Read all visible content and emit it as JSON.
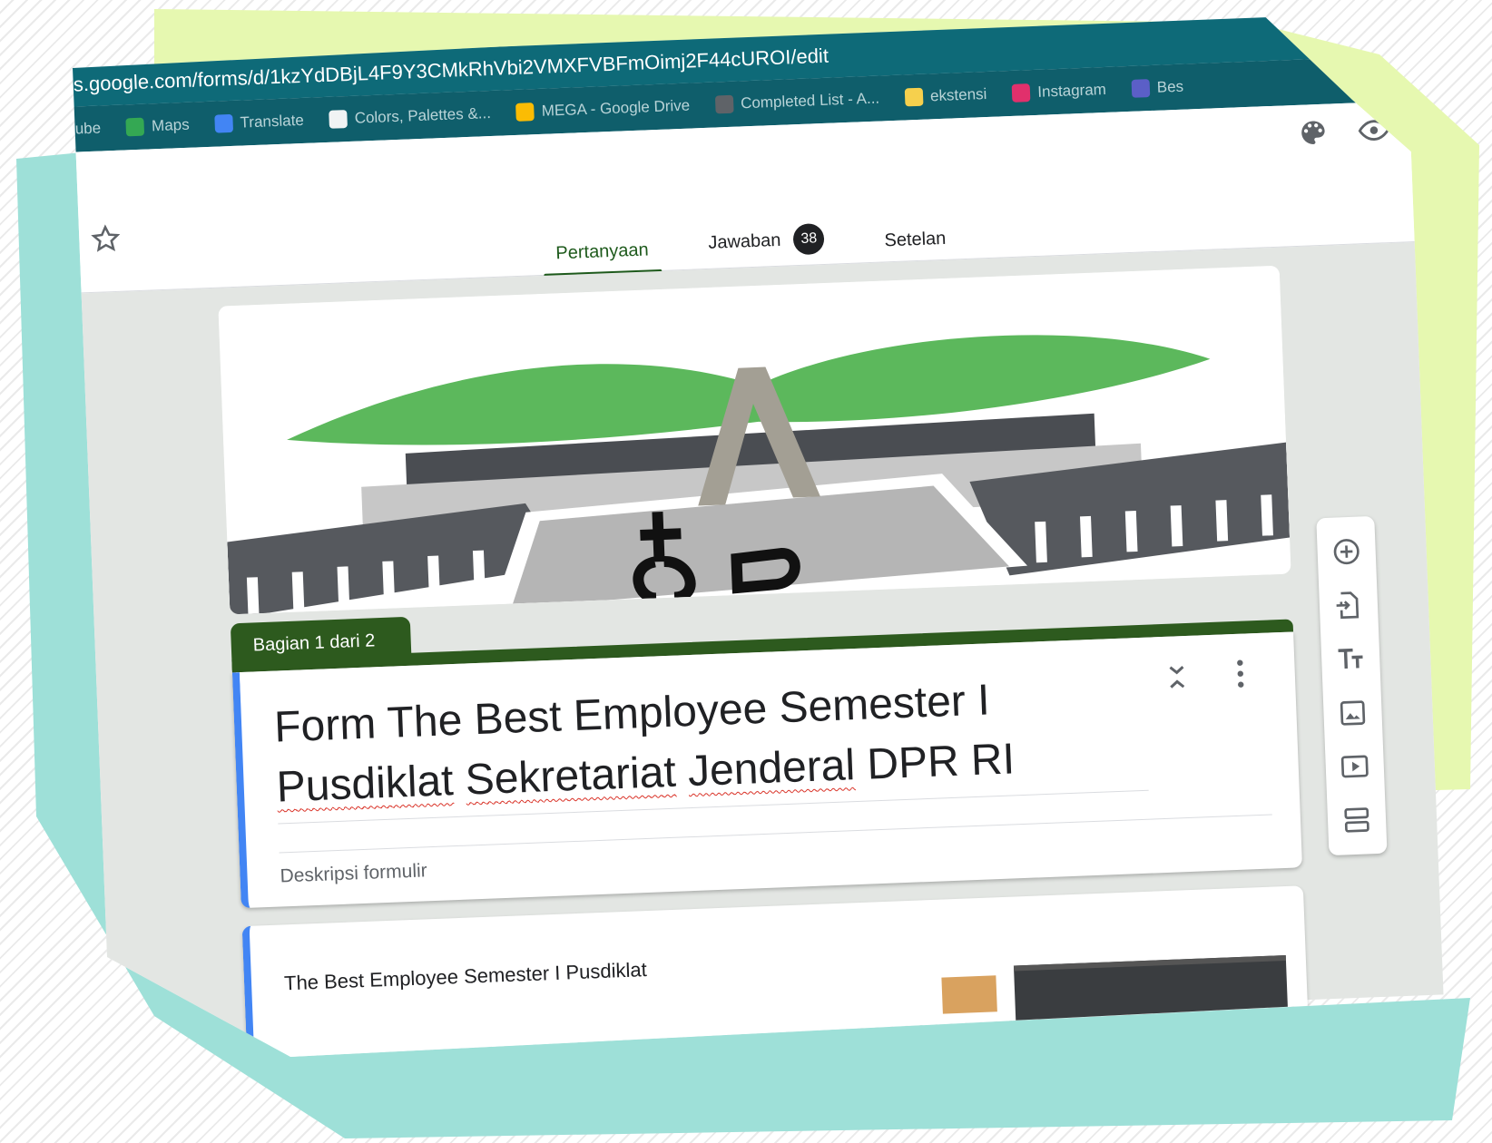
{
  "browser": {
    "url": "s.google.com/forms/d/1kzYdDBjL4F9Y3CMkRhVbi2VMXFVBFmOimj2F44cUROI/edit",
    "bookmarks": [
      {
        "label": "ube",
        "color": "#b9d4d8"
      },
      {
        "label": "Maps",
        "color": "#34a853"
      },
      {
        "label": "Translate",
        "color": "#4285f4"
      },
      {
        "label": "Colors, Palettes &...",
        "color": "#f1f3f4"
      },
      {
        "label": "MEGA - Google Drive",
        "color": "#fbbc04"
      },
      {
        "label": "Completed List - A...",
        "color": "#5f6368"
      },
      {
        "label": "ekstensi",
        "color": "#f6d04d"
      },
      {
        "label": "Instagram",
        "color": "#e1306c"
      },
      {
        "label": "Bes",
        "color": "#5b5fc7"
      }
    ]
  },
  "tabs": {
    "questions": "Pertanyaan",
    "responses": "Jawaban",
    "responses_count": "38",
    "settings": "Setelan"
  },
  "section": {
    "label": "Bagian 1 dari 2"
  },
  "form": {
    "title_line1": "Form The Best Employee Semester I",
    "title_w1": "Pusdiklat",
    "title_w2": "Sekretariat",
    "title_w3": "Jenderal",
    "title_w4": "DPR RI",
    "description_placeholder": "Deskripsi formulir"
  },
  "question": {
    "title": "The Best Employee Semester I Pusdiklat"
  },
  "colors": {
    "theme_green": "#2d5a1e",
    "accent_blue": "#4285f4",
    "chrome_teal": "#0e6a78"
  }
}
